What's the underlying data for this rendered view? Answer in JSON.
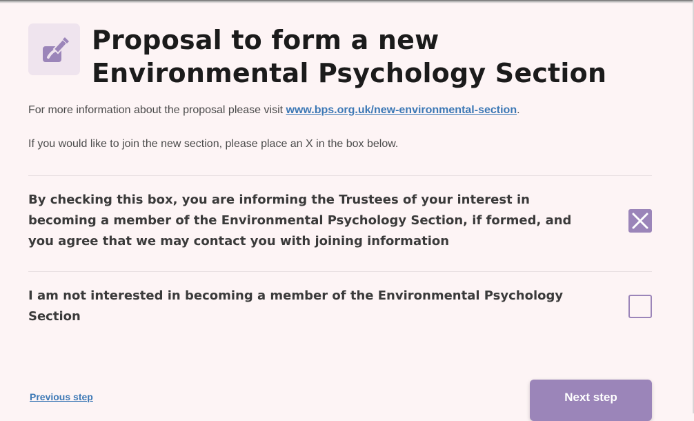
{
  "form": {
    "title": "Proposal to form a new Environmental Psychology Section",
    "info_prefix": "For more information about the proposal please visit ",
    "info_link": "www.bps.org.uk/new-environmental-section",
    "info_suffix": ".",
    "instruction": "If you would like to join the new section, please place an X in the box below.",
    "options": [
      {
        "label": "By checking this box, you are informing the Trustees of your interest in becoming a member of the Environmental Psychology Section, if formed, and you agree that we may contact you with joining information",
        "checked": true
      },
      {
        "label": "I am not interested in becoming a member of the Environmental Psychology Section",
        "checked": false
      }
    ]
  },
  "navigation": {
    "previous_label": "Previous step",
    "next_label": "Next step"
  },
  "colors": {
    "background": "#fdf4f5",
    "accent": "#9b85b9",
    "link": "#3c78b5",
    "icon_tile": "#efe4ee"
  },
  "icons": {
    "header_icon": "edit-document-icon",
    "checked_mark": "x-mark-icon"
  }
}
